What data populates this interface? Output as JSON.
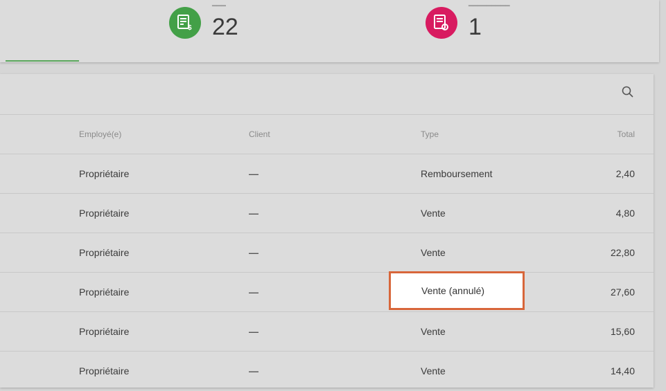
{
  "summary": {
    "stats": [
      {
        "value": "22",
        "icon": "receipt-dollar-icon",
        "color": "#43a047"
      },
      {
        "value": "1",
        "icon": "receipt-refund-icon",
        "color": "#d81b60"
      }
    ],
    "active_tab_color": "#59a65a"
  },
  "table": {
    "search_icon": "search-icon",
    "columns": [
      "Employé(e)",
      "Client",
      "Type",
      "Total"
    ],
    "rows": [
      {
        "employee": "Propriétaire",
        "client": "—",
        "type": "Remboursement",
        "total": "2,40"
      },
      {
        "employee": "Propriétaire",
        "client": "—",
        "type": "Vente",
        "total": "4,80"
      },
      {
        "employee": "Propriétaire",
        "client": "—",
        "type": "Vente",
        "total": "22,80"
      },
      {
        "employee": "Propriétaire",
        "client": "—",
        "type": "Vente (annulé)",
        "total": "27,60"
      },
      {
        "employee": "Propriétaire",
        "client": "—",
        "type": "Vente",
        "total": "15,60"
      },
      {
        "employee": "Propriétaire",
        "client": "—",
        "type": "Vente",
        "total": "14,40"
      }
    ],
    "highlight_color": "#d8663a"
  }
}
